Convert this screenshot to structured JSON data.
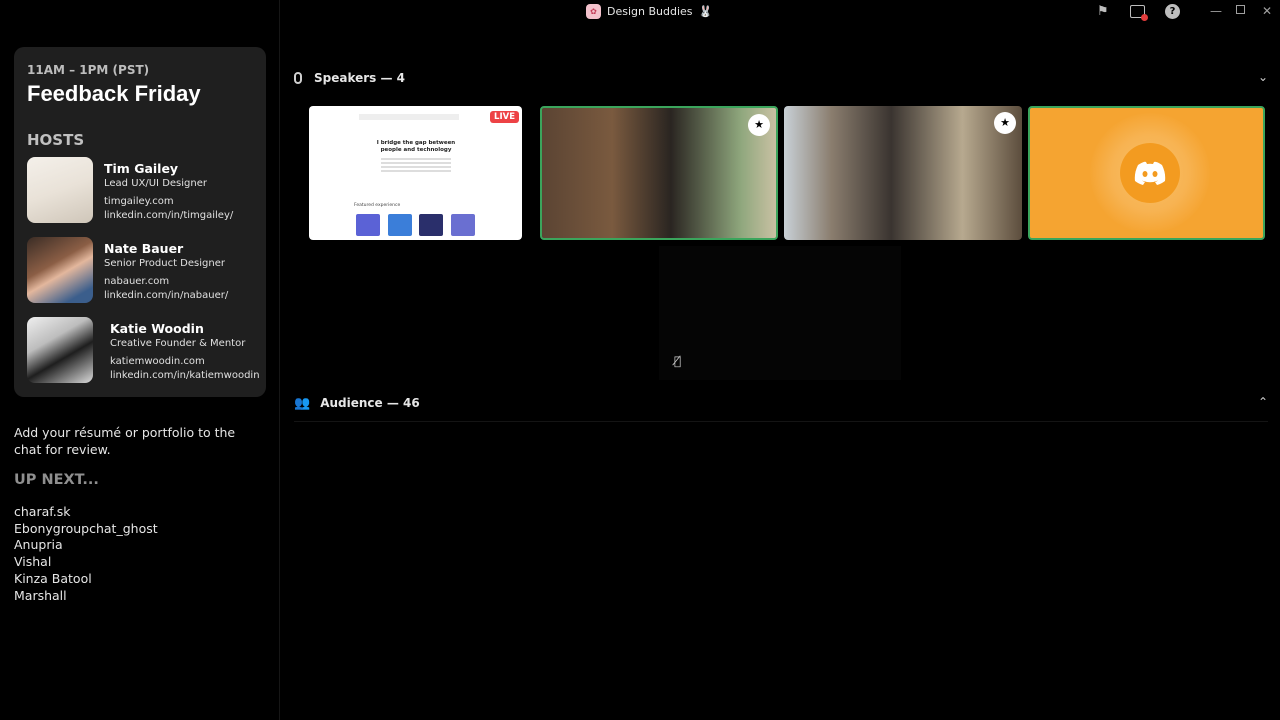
{
  "window": {
    "server_name": "Design Buddies",
    "server_emoji": "🐰"
  },
  "event": {
    "time": "11AM – 1PM (PST)",
    "title": "Feedback Friday",
    "hosts_label": "HOSTS",
    "hosts": [
      {
        "name": "Tim Gailey",
        "role": "Lead UX/UI Designer",
        "site": "timgailey.com",
        "linkedin": "linkedin.com/in/timgailey/"
      },
      {
        "name": "Nate Bauer",
        "role": "Senior Product Designer",
        "site": "nabauer.com",
        "linkedin": "linkedin.com/in/nabauer/"
      },
      {
        "name": "Katie Woodin",
        "role": "Creative Founder & Mentor",
        "site": "katiemwoodin.com",
        "linkedin": "linkedin.com/in/katiemwoodin"
      }
    ],
    "note": "Add your résumé or portfolio to the chat for review.",
    "up_next_label": "UP NEXT...",
    "queue": [
      "charaf.sk",
      "Ebonygroupchat_ghost",
      "Anupria",
      "Vishal",
      "Kinza Batool",
      "Marshall"
    ]
  },
  "stage": {
    "speakers_label": "Speakers — 4",
    "audience_label": "Audience — 46",
    "live_badge": "LIVE",
    "screen_share": {
      "headline": "I bridge the gap between people and technology",
      "section": "Featured experience"
    }
  },
  "colors": {
    "speaking_border": "#3ba55c",
    "live_red": "#ed4245",
    "discord_orange": "#f5a431"
  }
}
